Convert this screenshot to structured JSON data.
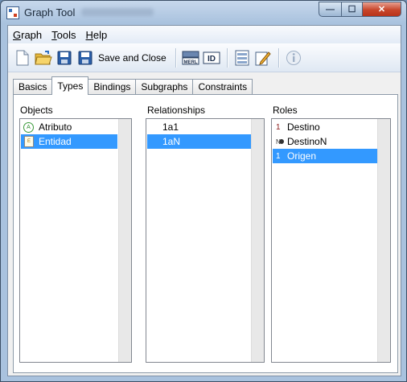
{
  "window": {
    "title": "Graph Tool"
  },
  "titlebar_buttons": {
    "minimize": "—",
    "maximize": "☐",
    "close": "✕"
  },
  "menu": [
    {
      "label": "Graph",
      "mnemonic_index": 0
    },
    {
      "label": "Tools",
      "mnemonic_index": 0
    },
    {
      "label": "Help",
      "mnemonic_index": 0
    }
  ],
  "toolbar": {
    "save_and_close_label": "Save and Close",
    "merl_label": "MERL",
    "id_label": "ID",
    "icons": [
      "new-document-icon",
      "open-folder-icon",
      "save-icon",
      "save-close-icon",
      "merl-icon",
      "id-icon",
      "properties-icon",
      "edit-icon",
      "info-icon"
    ]
  },
  "tabs": [
    {
      "label": "Basics",
      "active": false
    },
    {
      "label": "Types",
      "active": true
    },
    {
      "label": "Bindings",
      "active": false
    },
    {
      "label": "Subgraphs",
      "active": false
    },
    {
      "label": "Constraints",
      "active": false
    }
  ],
  "columns": {
    "objects": {
      "label": "Objects",
      "items": [
        {
          "label": "Atributo",
          "icon": "attribute-icon",
          "icon_text": "A",
          "selected": false
        },
        {
          "label": "Entidad",
          "icon": "entity-icon",
          "icon_text": "E",
          "selected": true
        }
      ]
    },
    "relationships": {
      "label": "Relationships",
      "items": [
        {
          "label": "1a1",
          "selected": false
        },
        {
          "label": "1aN",
          "selected": true
        }
      ]
    },
    "roles": {
      "label": "Roles",
      "items": [
        {
          "label": "Destino",
          "marker": "1",
          "selected": false
        },
        {
          "label": "DestinoN",
          "marker": "N",
          "selected": false
        },
        {
          "label": "Origen",
          "marker": "1",
          "selected": true
        }
      ]
    }
  },
  "colors": {
    "selection": "#3399ff",
    "window_frame": "#a9c2de",
    "close_button": "#c7462b"
  }
}
